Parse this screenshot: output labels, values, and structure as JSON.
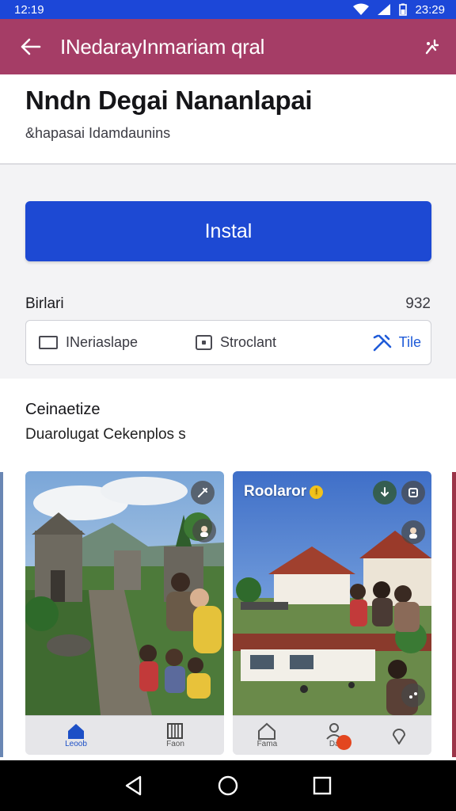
{
  "status_bar": {
    "time_left": "12:19",
    "time_right": "23:29"
  },
  "app_bar": {
    "title": "INedarayInmariam qral",
    "back_icon": "arrow-back-icon",
    "menu_icon": "sparkle-menu-icon",
    "color": "#a53d66"
  },
  "header": {
    "app_name": "Nndn Degai Nananlapai",
    "subtitle": "&hapasai Idamdaunins"
  },
  "install_button": {
    "label": "Instal",
    "color": "#1d49d3"
  },
  "details": {
    "label": "Birlari",
    "count": "932",
    "items": [
      {
        "label": "INeriaslape",
        "icon": "tablet-icon"
      },
      {
        "label": "Stroclant",
        "icon": "square-dot-icon"
      },
      {
        "label": "Tile",
        "icon": "tools-icon"
      }
    ]
  },
  "gallery": {
    "title": "Ceinaetize",
    "subtitle": "Duarolugat Cekenplos s",
    "screenshots": [
      {
        "nav": [
          {
            "label": "Leoob",
            "icon": "home-icon",
            "active": true
          },
          {
            "label": "Faon",
            "icon": "calendar-icon",
            "active": false
          }
        ]
      },
      {
        "caption": "Roolaror",
        "nav": [
          {
            "label": "Fama",
            "icon": "home-outline-icon",
            "active": false
          },
          {
            "label": "Da",
            "icon": "person-icon",
            "active": false
          },
          {
            "label": "",
            "icon": "location-icon",
            "active": false
          }
        ]
      }
    ]
  },
  "system_nav": {
    "back_icon": "triangle-back-icon",
    "home_icon": "circle-home-icon",
    "recents_icon": "square-recents-icon"
  }
}
